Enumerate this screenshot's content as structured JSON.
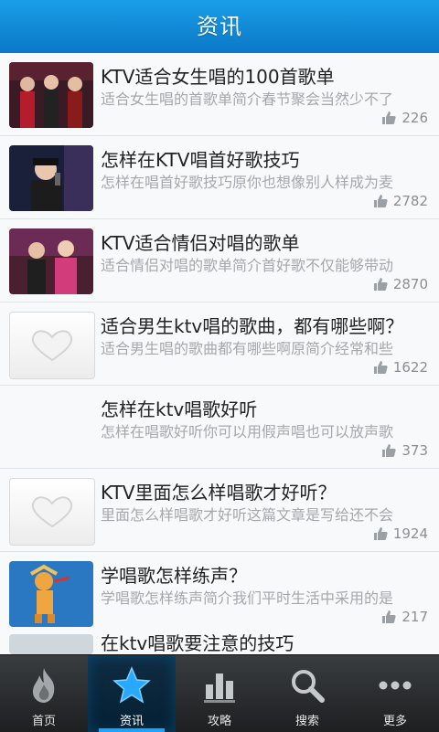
{
  "header": {
    "title": "资讯"
  },
  "articles": [
    {
      "title": "KTV适合女生唱的100首歌单",
      "desc": "适合女生唱的首歌单简介春节聚会当然少不了",
      "likes": "226",
      "thumb": "photo"
    },
    {
      "title": "怎样在KTV唱首好歌技巧",
      "desc": "怎样在唱首好歌技巧原你也想像别人样成为麦",
      "likes": "2782",
      "thumb": "photo"
    },
    {
      "title": "KTV适合情侣对唱的歌单",
      "desc": "适合情侣对唱的歌单简介首好歌不仅能够带动",
      "likes": "2870",
      "thumb": "photo"
    },
    {
      "title": "适合男生ktv唱的歌曲，都有哪些啊？",
      "desc": "适合男生唱的歌曲都有哪些啊原简介经常和些",
      "likes": "1622",
      "thumb": "placeholder"
    },
    {
      "title": "怎样在ktv唱歌好听",
      "desc": "怎样在唱歌好听你可以用假声唱也可以放声歌",
      "likes": "373",
      "thumb": "none"
    },
    {
      "title": "KTV里面怎么样唱歌才好听？",
      "desc": "里面怎么样唱歌才好听这篇文章是写给还不会",
      "likes": "1924",
      "thumb": "placeholder"
    },
    {
      "title": "学唱歌怎样练声？",
      "desc": "学唱歌怎样练声简介我们平时生活中采用的是",
      "likes": "217",
      "thumb": "illustration"
    }
  ],
  "partial_article": {
    "title": "在ktv唱歌要注意的技巧"
  },
  "tabs": [
    {
      "label": "首页",
      "icon": "flame-icon"
    },
    {
      "label": "资讯",
      "icon": "star-icon",
      "active": true
    },
    {
      "label": "攻略",
      "icon": "bar-chart-icon"
    },
    {
      "label": "搜索",
      "icon": "search-icon"
    },
    {
      "label": "更多",
      "icon": "more-dots-icon"
    }
  ],
  "colors": {
    "header": "#0a78c6",
    "active_tab": "#1aa3ff"
  }
}
